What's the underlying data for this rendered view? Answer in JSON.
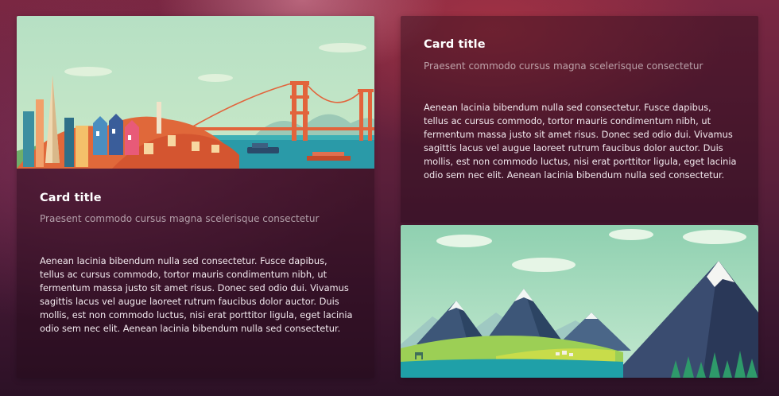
{
  "cards": [
    {
      "image": "city-skyline-illustration",
      "title": "Card title",
      "subtitle": "Praesent commodo cursus magna scelerisque consectetur",
      "body": "Aenean lacinia bibendum nulla sed consectetur. Fusce dapibus, tellus ac cursus commodo, tortor mauris condimentum nibh, ut fermentum massa justo sit amet risus. Donec sed odio dui. Vivamus sagittis lacus vel augue laoreet rutrum faucibus dolor auctor. Duis mollis, est non commodo luctus, nisi erat porttitor ligula, eget lacinia odio sem nec elit. Aenean lacinia bibendum nulla sed consectetur."
    },
    {
      "title": "Card title",
      "subtitle": "Praesent commodo cursus magna scelerisque consectetur",
      "body": "Aenean lacinia bibendum nulla sed consectetur. Fusce dapibus, tellus ac cursus commodo, tortor mauris condimentum nibh, ut fermentum massa justo sit amet risus. Donec sed odio dui. Vivamus sagittis lacus vel augue laoreet rutrum faucibus dolor auctor. Duis mollis, est non commodo luctus, nisi erat porttitor ligula, eget lacinia odio sem nec elit. Aenean lacinia bibendum nulla sed consectetur."
    },
    {
      "image": "mountain-landscape-illustration"
    }
  ],
  "colors": {
    "background": "#5a1f3a",
    "card_overlay": "#230a19",
    "title": "#ffffff",
    "bridge": "#e0603a",
    "water": "#1f8ea0",
    "sky": "#a8dbc0",
    "meadow": "#9ccf55",
    "mountain": "#3a4a6a"
  }
}
